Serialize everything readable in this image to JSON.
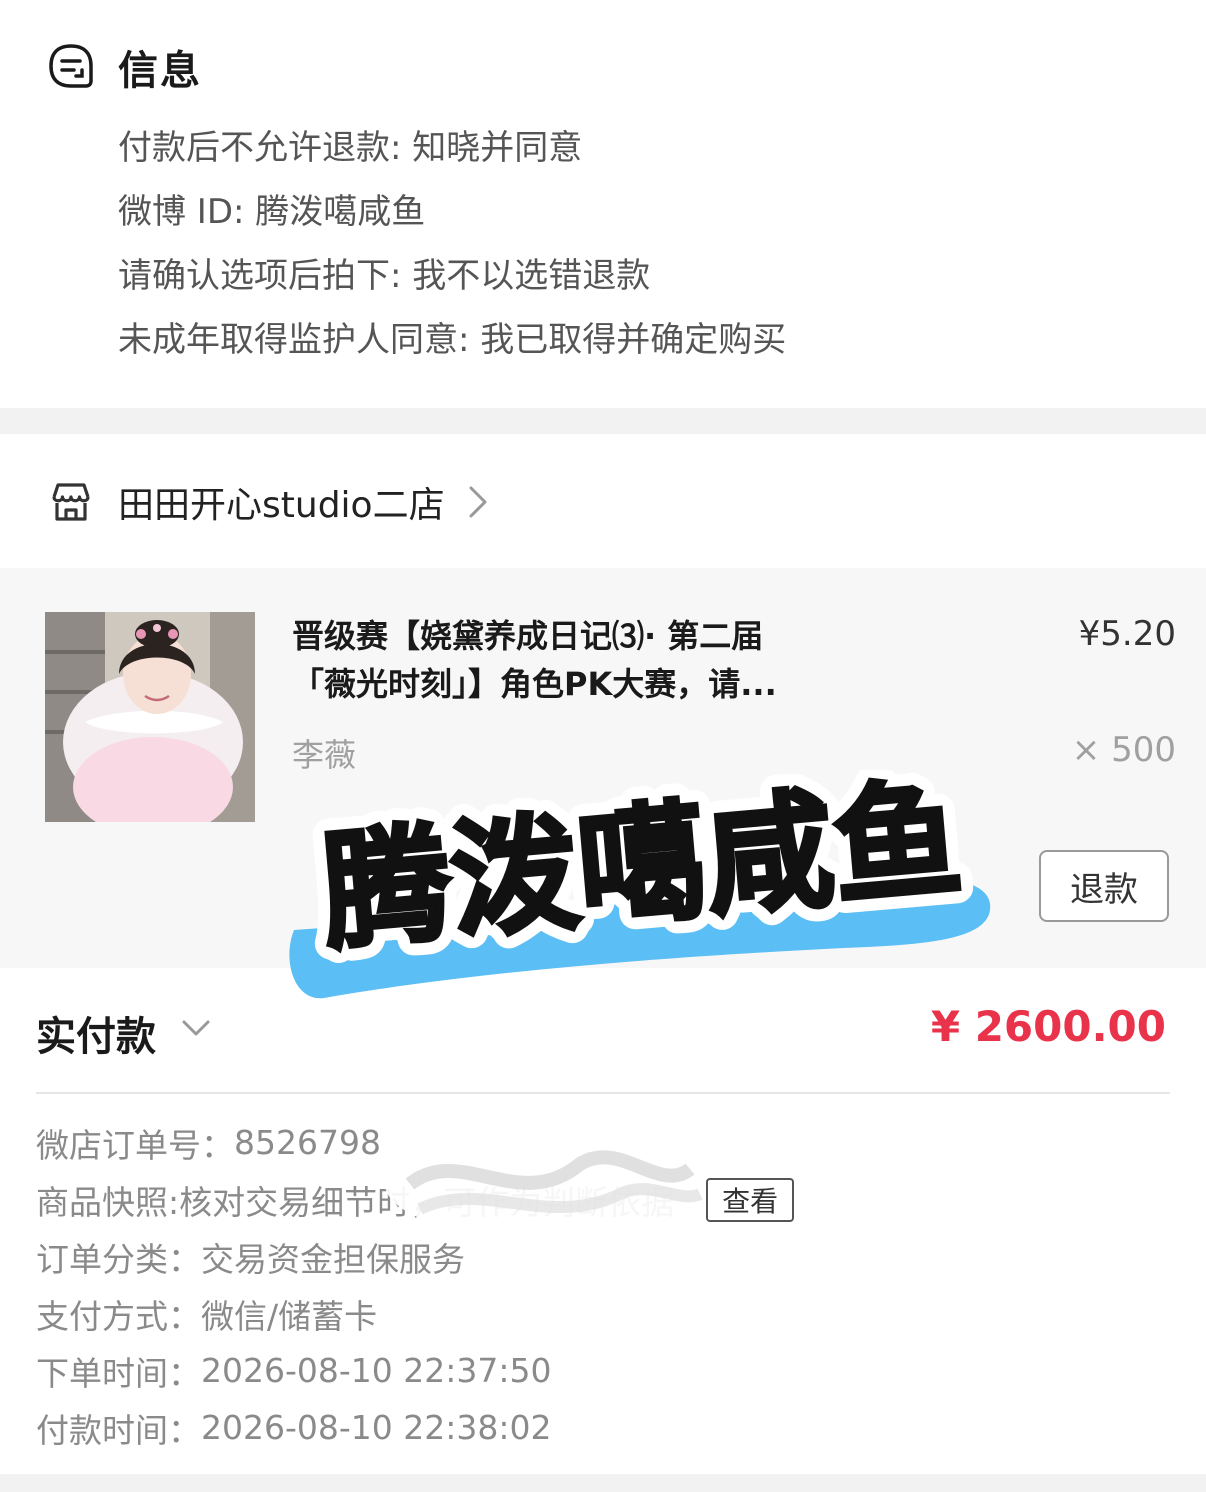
{
  "info": {
    "title": "信息",
    "lines": [
      "付款后不允许退款: 知晓并同意",
      "微博 ID: 腾泼噶咸鱼",
      "请确认选项后拍下: 我不以选错退款",
      "未成年取得监护人同意: 我已取得并确定购买"
    ]
  },
  "shop": {
    "name": "田田开心studio二店"
  },
  "item": {
    "title": "晋级赛【娆黛养成日记⑶· 第二届「薇光时刻」】角色PK大赛，请...",
    "title_line1": "晋级赛【娆黛养成日记⑶· 第二届",
    "title_line2": "「薇光时刻」】角色PK大赛，请...",
    "price": "¥5.20",
    "sku": "李薇",
    "quantity": "× 500",
    "refund_label": "退款"
  },
  "watermark": {
    "text": "腾泼噶咸鱼"
  },
  "payment": {
    "label": "实付款",
    "amount": "¥ 2600.00",
    "accent_color": "#e8334b"
  },
  "details": {
    "order_no_label": "微店订单号：",
    "order_no_value": "8526798",
    "snapshot_label": "商品快照:",
    "snapshot_value": "核对交易细节时，可作为判断依据",
    "snapshot_button": "查看",
    "category_label": "订单分类：",
    "category_value": "交易资金担保服务",
    "pay_method_label": "支付方式：",
    "pay_method_value": "微信/储蓄卡",
    "order_time_label": "下单时间：",
    "order_time_value": "2026-08-10 22:37:50",
    "pay_time_label": "付款时间：",
    "pay_time_value": "2026-08-10 22:38:02"
  }
}
